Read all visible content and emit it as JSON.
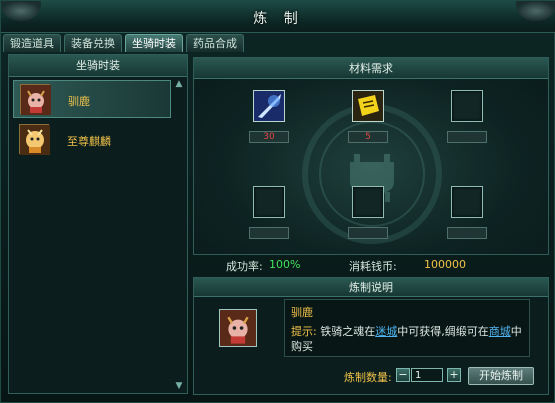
{
  "window": {
    "title": "炼 制"
  },
  "tabs": [
    {
      "label": "锻造道具",
      "active": false
    },
    {
      "label": "装备兑换",
      "active": false
    },
    {
      "label": "坐骑时装",
      "active": true
    },
    {
      "label": "药品合成",
      "active": false
    }
  ],
  "mount_list": {
    "header": "坐骑时装",
    "items": [
      {
        "name": "驯鹿",
        "selected": true,
        "icon": "reindeer-mount-icon"
      },
      {
        "name": "至尊麒麟",
        "selected": false,
        "icon": "qilin-mount-icon"
      }
    ]
  },
  "materials": {
    "header": "材料需求",
    "slots": [
      {
        "icon": "blue-sword-soul-icon",
        "count": "30",
        "filled": true
      },
      {
        "icon": "yellow-flag-scroll-icon",
        "count": "5",
        "filled": true
      },
      {
        "icon": "",
        "count": "",
        "filled": false
      },
      {
        "icon": "",
        "count": "",
        "filled": false
      },
      {
        "icon": "",
        "count": "",
        "filled": false
      },
      {
        "icon": "",
        "count": "",
        "filled": false
      }
    ]
  },
  "stats": {
    "success_label": "成功率:",
    "success_value": "100%",
    "cost_label": "消耗钱币:",
    "cost_value": "100000"
  },
  "description": {
    "header": "炼制说明",
    "item_name": "驯鹿",
    "tip_label": "提示:",
    "tip_text_1": "铁骑之魂在",
    "tip_link_1": "迷城",
    "tip_text_2": "中可获得,绸缎可在",
    "tip_link_2": "商城",
    "tip_text_3": "中购买"
  },
  "quantity": {
    "label": "炼制数量:",
    "value": "1",
    "minus": "−",
    "plus": "+"
  },
  "actions": {
    "start_label": "开始炼制"
  },
  "colors": {
    "accent_gold": "#f0c24a",
    "success_green": "#42e05a",
    "count_red": "#e34545",
    "link_blue": "#4fb4f0"
  }
}
